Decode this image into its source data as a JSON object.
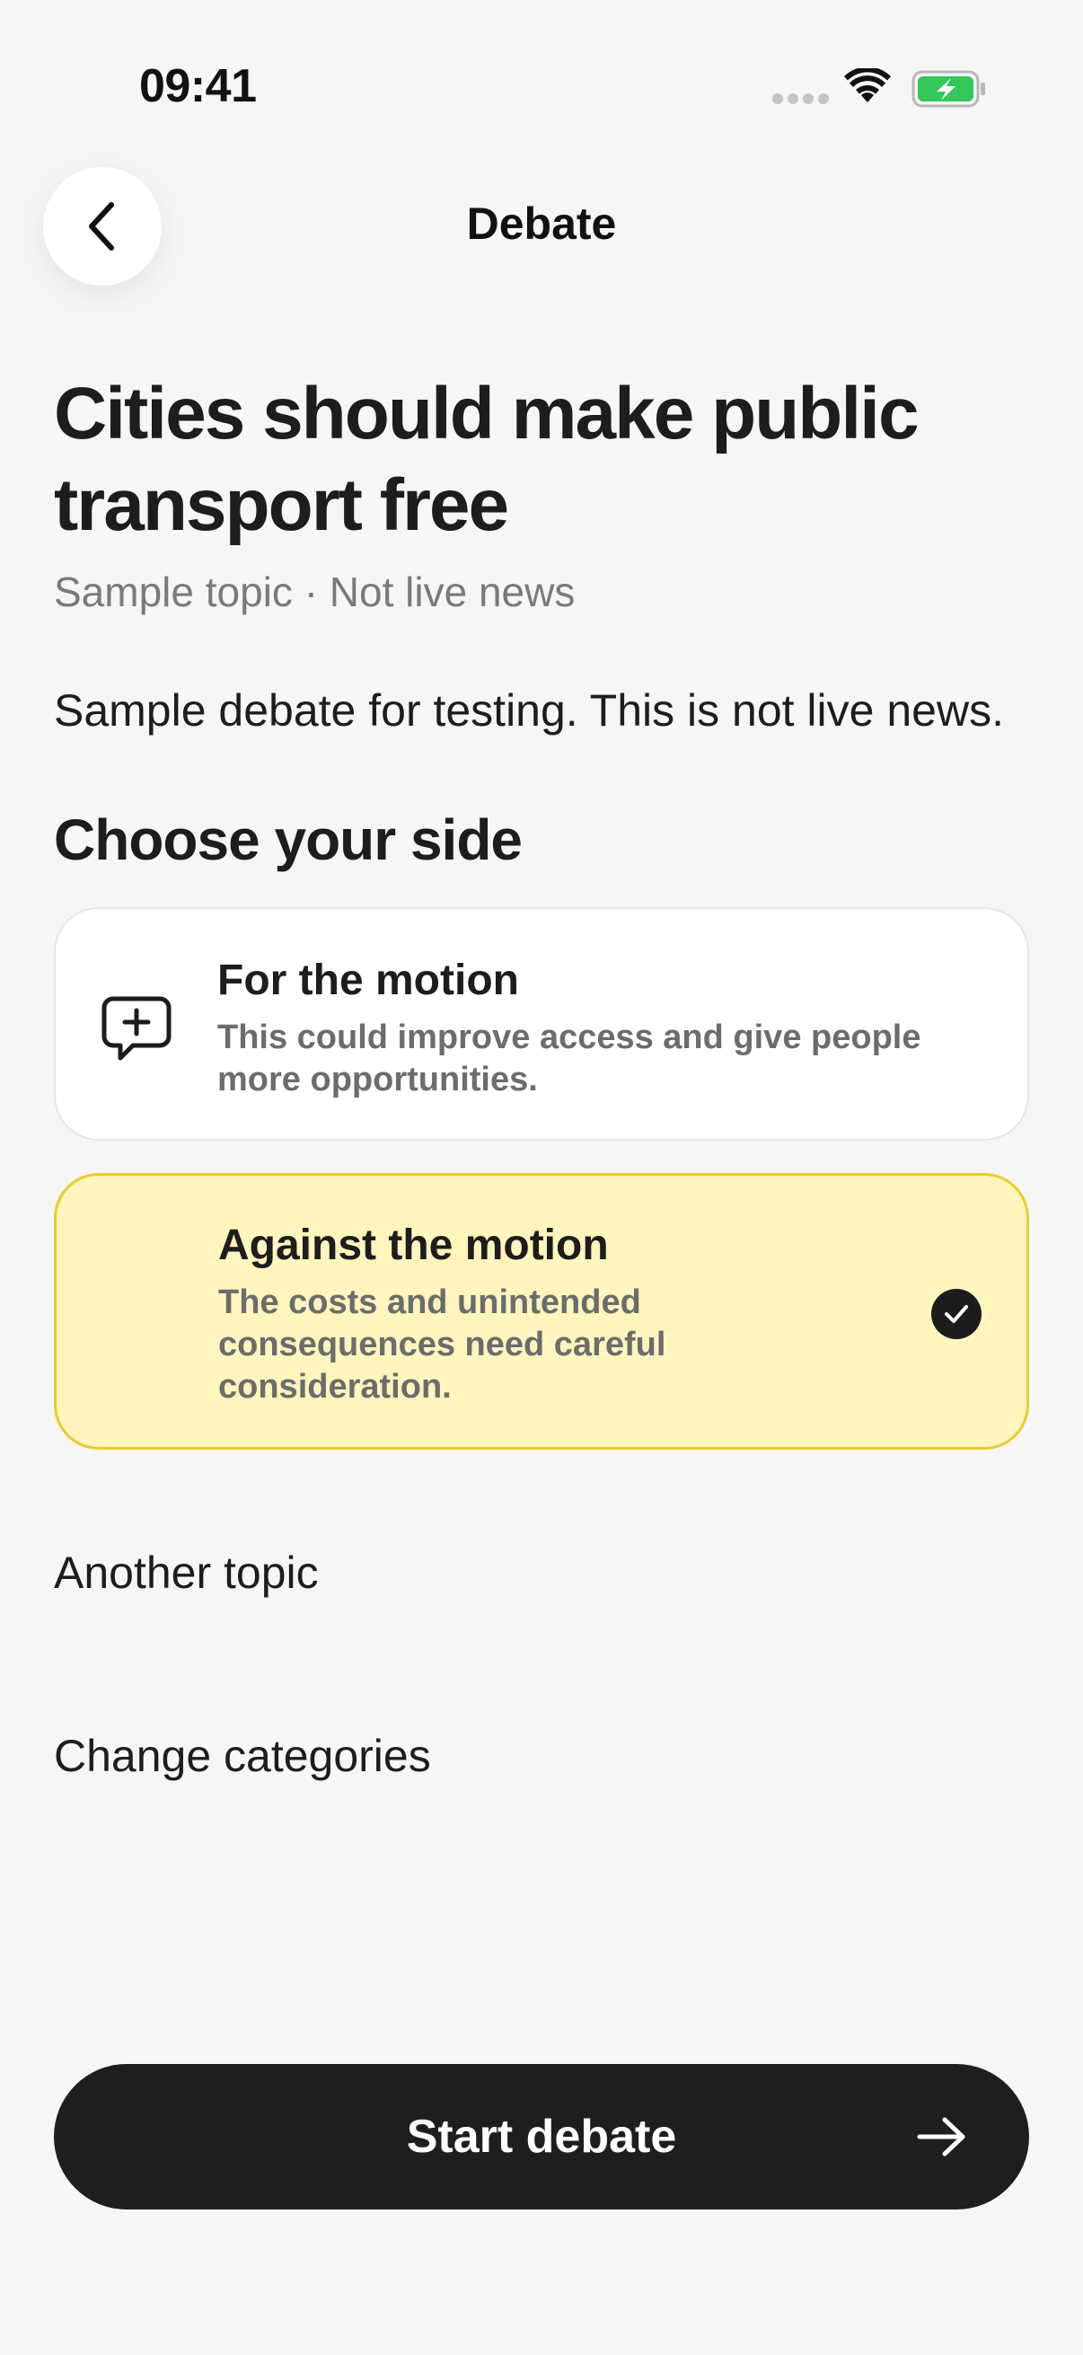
{
  "status_bar": {
    "time": "09:41",
    "signal_icon": "cellular-signal-dots",
    "wifi_icon": "wifi-icon",
    "battery_icon": "battery-charging-icon",
    "battery_color": "#34c759"
  },
  "nav": {
    "back_icon": "chevron-left-icon",
    "title": "Debate"
  },
  "topic": {
    "title": "Cities should make public transport free",
    "subtitle": "Sample topic · Not live news",
    "description": "Sample debate for testing. This is not live news."
  },
  "choose_side": {
    "heading": "Choose your side",
    "options": [
      {
        "title": "For the motion",
        "description": "This could improve access and give people more opportunities.",
        "icon": "chat-bubble-plus-icon",
        "selected": false
      },
      {
        "title": "Against the motion",
        "description": "The costs and unintended consequences need careful consideration.",
        "icon": "checkmark-icon",
        "selected": true
      }
    ]
  },
  "links": {
    "another_topic": "Another topic",
    "change_categories": "Change categories"
  },
  "primary_action": {
    "label": "Start debate",
    "icon": "arrow-right-icon"
  },
  "colors": {
    "background": "#f6f6f6",
    "selected_card_bg": "#fff5bd",
    "selected_card_border": "#eccb29",
    "primary_button": "#1e1e1e"
  }
}
